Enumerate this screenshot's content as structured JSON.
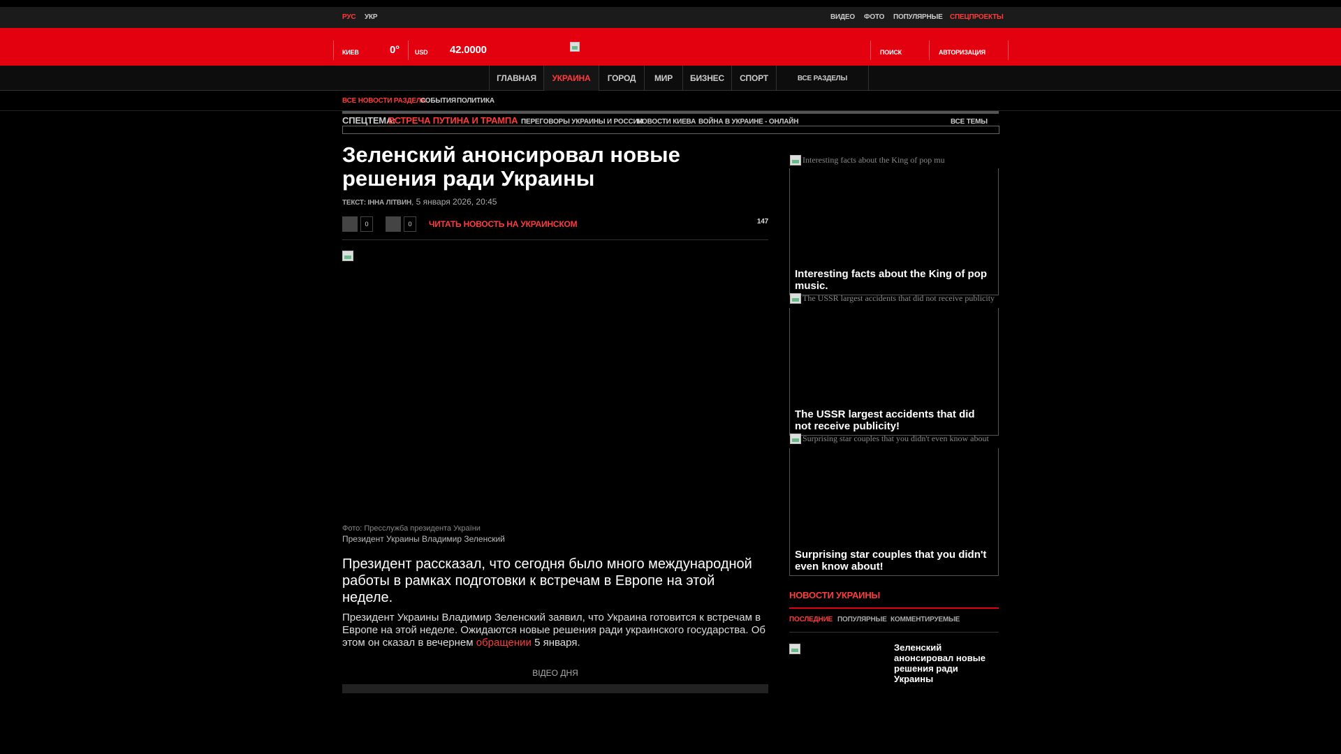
{
  "top": {
    "lang_ru": "РУС",
    "lang_ukr": "УКР",
    "links": [
      "ВИДЕО",
      "ФОТО",
      "ПОПУЛЯРНЫЕ",
      "СПЕЦПРОЕКТЫ"
    ]
  },
  "header": {
    "city": "КИЕВ",
    "temperature": "0°",
    "currency": "USD",
    "rate": "42.0000",
    "search": "ПОИСК",
    "login": "АВТОРИЗАЦИЯ"
  },
  "nav": {
    "tabs": [
      "ГЛАВНАЯ",
      "УКРАИНА",
      "ГОРОД",
      "МИР",
      "БИЗНЕС",
      "СПОРТ"
    ],
    "all_sections": "ВСЕ РАЗДЕЛЫ",
    "active_tab": "УКРАИНА"
  },
  "subnav": {
    "items": [
      "ВСЕ НОВОСТИ РАЗДЕЛА",
      "СОБЫТИЯ",
      "ПОЛИТИКА"
    ]
  },
  "special": {
    "label": "СПЕЦТЕМА:",
    "topic": "ВСТРЕЧА ПУТИНА И ТРАМПА",
    "items": [
      "ПЕРЕГОВОРЫ УКРАИНЫ И РОССИИ",
      "НОВОСТИ КИЕВА",
      "ВОЙНА В УКРАИНЕ - ОНЛАЙН"
    ],
    "all_topics": "ВСЕ ТЕМЫ"
  },
  "article": {
    "title": "Зеленский анонсировал новые решения ради Украины",
    "author": "ТЕКСТ: ІННА ЛІТВИН",
    "date": "5 января 2026, 20:45",
    "share_count_1": "0",
    "share_count_2": "0",
    "read_in_ukrainian": "ЧИТАТЬ НОВОСТЬ НА УКРАИНСКОМ",
    "views": "147",
    "photo_credit": "Фото: Пресслужба президента України",
    "photo_caption": "Президент Украины Владимир Зеленский",
    "lead": "Президент рассказал, что сегодня было много международной работы в рамках подготовки к встречам в Европе на этой неделе.",
    "body_before": "Президент Украины Владимир Зеленский заявил, что Украина готовится к встречам в Европе на этой неделе. Ожидаются новые решения ради украинского государства. Об этом он сказал в вечернем ",
    "body_link": "обращении",
    "body_after": " 5 января.",
    "video_of_day": "ВІДЕО ДНЯ"
  },
  "promos": [
    {
      "alt": "Interesting facts about the King of pop mu",
      "title": "Interesting facts about the King of pop music."
    },
    {
      "alt": "The USSR largest accidents that did not receive publicity",
      "title": "The USSR largest accidents that did not receive publicity!"
    },
    {
      "alt": "Surprising star couples that you didn't even know about",
      "title": "Surprising star couples that you didn't even know about!"
    }
  ],
  "ukraine_news": {
    "title": "НОВОСТИ УКРАИНЫ",
    "tabs": [
      "ПОСЛЕДНИЕ",
      "ПОПУЛЯРНЫЕ",
      "КОММЕНТИРУЕМЫЕ"
    ],
    "active_tab": "ПОСЛЕДНИЕ",
    "item_title": "Зеленский анонсировал новые решения ради Украины"
  },
  "colors": {
    "brand_red": "#e3000f",
    "accent_red": "#ff3b3b",
    "background": "#000000"
  },
  "icons": [
    "logo-icon",
    "broken-image-icon",
    "share-icon"
  ]
}
